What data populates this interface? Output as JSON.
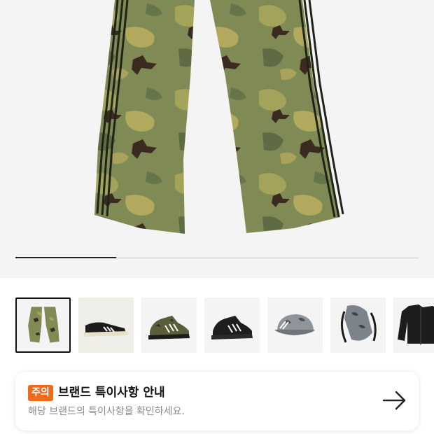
{
  "gallery": {
    "product_image": "camo-track-pants",
    "slide_progress": 0.25,
    "thumbnails": [
      {
        "name": "camo-pants",
        "selected": true
      },
      {
        "name": "black-sneaker",
        "selected": false
      },
      {
        "name": "camo-high-top-sneaker",
        "selected": false
      },
      {
        "name": "black-high-top-sneaker",
        "selected": false
      },
      {
        "name": "camo-cap",
        "selected": false
      },
      {
        "name": "camo-sling-bag",
        "selected": false
      },
      {
        "name": "black-track-jacket",
        "selected": false
      }
    ]
  },
  "notice": {
    "badge": "주의",
    "title": "브랜드 특이사항 안내",
    "subtitle": "해당 브랜드의 특이사항을 확인하세요.",
    "arrow_icon": "arrow-right-icon"
  },
  "colors": {
    "badge_bg": "#ef6a1a",
    "camo_base": "#7f8a55",
    "stripe": "#1e2417"
  }
}
